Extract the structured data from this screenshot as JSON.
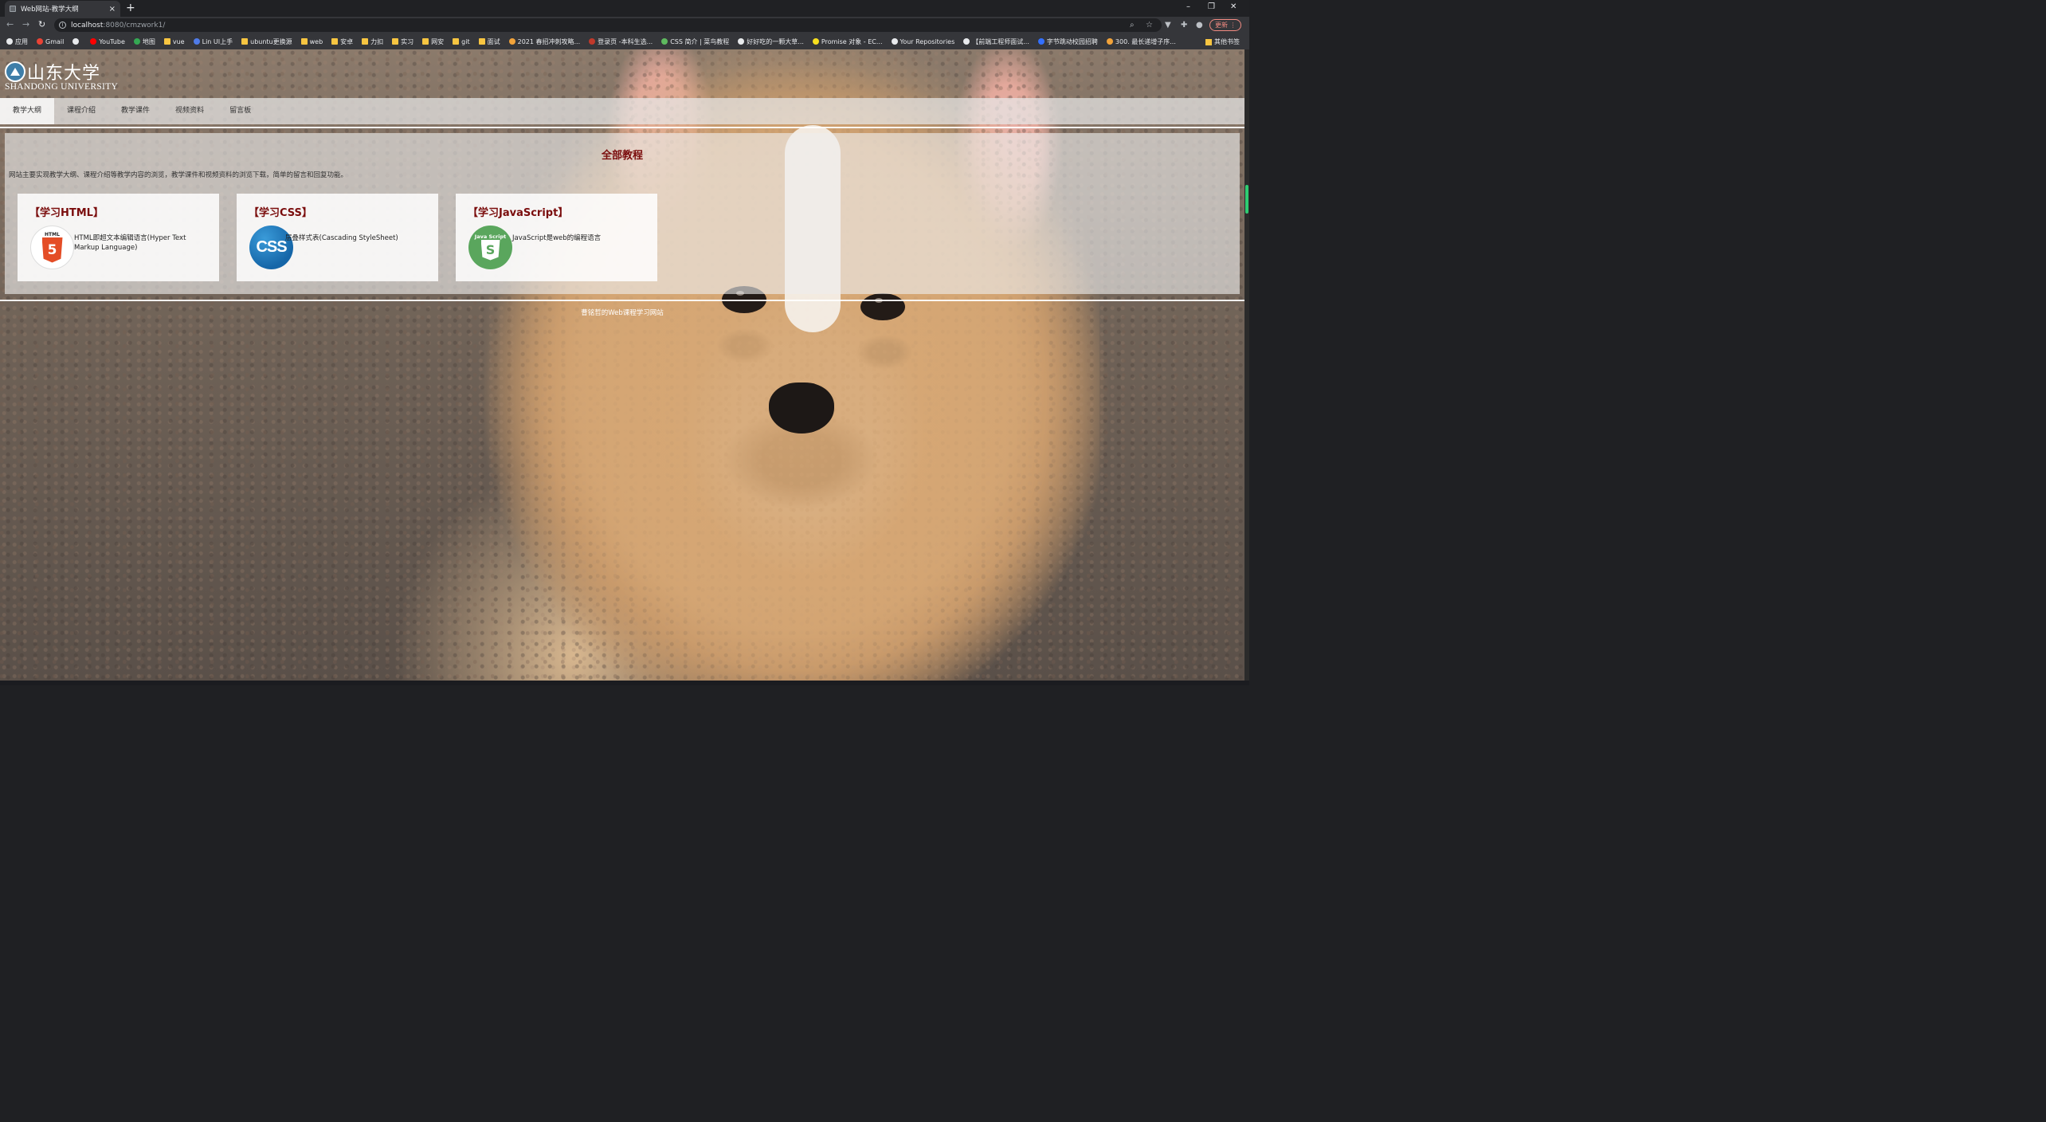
{
  "browser": {
    "tab_title": "Web网站-教学大纲",
    "tab_close": "×",
    "new_tab": "+",
    "url_host": "localhost",
    "url_rest": ":8080/cmzwork1/",
    "update_label": "更新",
    "window_controls": {
      "minimize": "–",
      "restore": "❐",
      "close": "✕"
    },
    "bookmarks": [
      {
        "label": "应用",
        "icon": "apps-icon",
        "color": "#e8eaed"
      },
      {
        "label": "Gmail",
        "icon": "gmail-icon",
        "color": "#ea4335"
      },
      {
        "label": "",
        "icon": "globe-icon",
        "color": "#e8eaed"
      },
      {
        "label": "YouTube",
        "icon": "youtube-icon",
        "color": "#ff0000"
      },
      {
        "label": "地图",
        "icon": "maps-icon",
        "color": "#34a853"
      },
      {
        "label": "vue",
        "icon": "folder-icon",
        "color": "#f8c541"
      },
      {
        "label": "Lin UI上手",
        "icon": "page-icon",
        "color": "#4f7be8"
      },
      {
        "label": "ubuntu更换源",
        "icon": "folder-icon",
        "color": "#f8c541"
      },
      {
        "label": "web",
        "icon": "folder-icon",
        "color": "#f8c541"
      },
      {
        "label": "安卓",
        "icon": "folder-icon",
        "color": "#f8c541"
      },
      {
        "label": "力扣",
        "icon": "folder-icon",
        "color": "#f8c541"
      },
      {
        "label": "实习",
        "icon": "folder-icon",
        "color": "#f8c541"
      },
      {
        "label": "网安",
        "icon": "folder-icon",
        "color": "#f8c541"
      },
      {
        "label": "git",
        "icon": "folder-icon",
        "color": "#f8c541"
      },
      {
        "label": "面试",
        "icon": "folder-icon",
        "color": "#f8c541"
      },
      {
        "label": "2021 春招冲刺攻略...",
        "icon": "page-icon",
        "color": "#f2a33a"
      },
      {
        "label": "登录页 -本科生选...",
        "icon": "page-icon",
        "color": "#c0392b"
      },
      {
        "label": "CSS 简介 | 菜鸟教程",
        "icon": "page-icon",
        "color": "#5fb95f"
      },
      {
        "label": "好好吃的一颗大草...",
        "icon": "page-icon",
        "color": "#e8eaed"
      },
      {
        "label": "Promise 对象 - EC...",
        "icon": "page-icon",
        "color": "#f7df1e"
      },
      {
        "label": "Your Repositories",
        "icon": "github-icon",
        "color": "#e8eaed"
      },
      {
        "label": "【前端工程师面试...",
        "icon": "page-icon",
        "color": "#e8eaed"
      },
      {
        "label": "字节跳动校园招聘",
        "icon": "page-icon",
        "color": "#3370ff"
      },
      {
        "label": "300. 最长递增子序...",
        "icon": "page-icon",
        "color": "#f2a33a"
      }
    ],
    "other_bookmarks": "其他书签"
  },
  "site": {
    "logo_cn": "山东大学",
    "logo_en": "SHANDONG UNIVERSITY",
    "nav": [
      {
        "label": "教学大纲",
        "active": true
      },
      {
        "label": "课程介绍",
        "active": false
      },
      {
        "label": "教学课件",
        "active": false
      },
      {
        "label": "视频资料",
        "active": false
      },
      {
        "label": "留言板",
        "active": false
      }
    ],
    "main": {
      "title": "全部教程",
      "description": "网站主要实现教学大纲、课程介绍等教学内容的浏览，教学课件和视频资料的浏览下载，简单的留言和回复功能。",
      "cards": [
        {
          "title": "【学习HTML】",
          "text": "HTML即超文本编辑语言(Hyper Text Markup Language)",
          "icon": "html5-icon",
          "icon_text": "5",
          "icon_label": "HTML"
        },
        {
          "title": "【学习CSS】",
          "text": "层叠样式表(Cascading StyleSheet)",
          "icon": "css-icon",
          "icon_text": "CSS",
          "icon_label": ""
        },
        {
          "title": "【学习JavaScript】",
          "text": "JavaScript是web的编程语言",
          "icon": "javascript-icon",
          "icon_text": "S",
          "icon_label": "Java Script"
        }
      ]
    },
    "footer": "曹铭哲的Web课程学习网站"
  },
  "colors": {
    "accent_title": "#7a0c0c",
    "chrome_bg": "#35363a",
    "scroll_thumb": "#2ecc71"
  }
}
